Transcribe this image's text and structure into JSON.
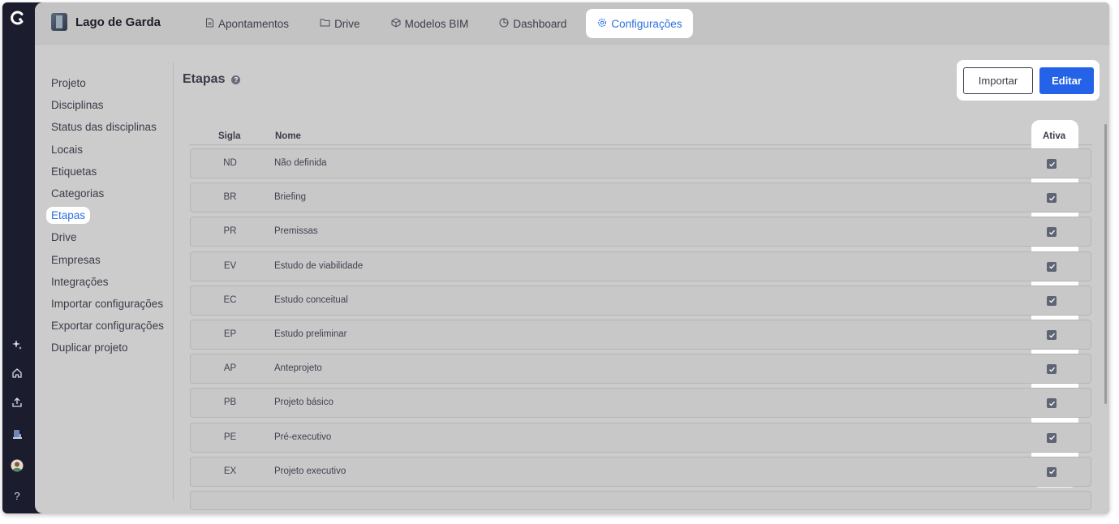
{
  "project": {
    "name": "Lago de Garda"
  },
  "tabs": [
    {
      "label": "Apontamentos",
      "icon": "document-icon"
    },
    {
      "label": "Drive",
      "icon": "folder-icon"
    },
    {
      "label": "Modelos BIM",
      "icon": "cube-icon"
    },
    {
      "label": "Dashboard",
      "icon": "pie-chart-icon"
    },
    {
      "label": "Configurações",
      "icon": "gear-icon",
      "active": true
    }
  ],
  "sidebar": {
    "items": [
      {
        "label": "Projeto"
      },
      {
        "label": "Disciplinas"
      },
      {
        "label": "Status das disciplinas"
      },
      {
        "label": "Locais"
      },
      {
        "label": "Etiquetas"
      },
      {
        "label": "Categorias"
      },
      {
        "label": "Etapas",
        "active": true
      },
      {
        "label": "Drive"
      },
      {
        "label": "Empresas"
      },
      {
        "label": "Integrações"
      },
      {
        "label": "Importar configurações"
      },
      {
        "label": "Exportar configurações"
      },
      {
        "label": "Duplicar projeto"
      }
    ]
  },
  "page": {
    "title": "Etapas",
    "help_glyph": "?",
    "import_label": "Importar",
    "edit_label": "Editar"
  },
  "table": {
    "headers": {
      "sigla": "Sigla",
      "nome": "Nome",
      "ativa": "Ativa"
    },
    "rows": [
      {
        "sigla": "ND",
        "nome": "Não definida",
        "ativa": true
      },
      {
        "sigla": "BR",
        "nome": "Briefing",
        "ativa": true
      },
      {
        "sigla": "PR",
        "nome": "Premissas",
        "ativa": true
      },
      {
        "sigla": "EV",
        "nome": "Estudo de viabilidade",
        "ativa": true
      },
      {
        "sigla": "EC",
        "nome": "Estudo conceitual",
        "ativa": true
      },
      {
        "sigla": "EP",
        "nome": "Estudo preliminar",
        "ativa": true
      },
      {
        "sigla": "AP",
        "nome": "Anteprojeto",
        "ativa": true
      },
      {
        "sigla": "PB",
        "nome": "Projeto básico",
        "ativa": true
      },
      {
        "sigla": "PE",
        "nome": "Pré-executivo",
        "ativa": true
      },
      {
        "sigla": "EX",
        "nome": "Projeto executivo",
        "ativa": true
      },
      {
        "sigla": "",
        "nome": "",
        "ativa": true
      }
    ]
  },
  "rail": {
    "icons": [
      "sparkle-icon",
      "home-icon",
      "upload-icon",
      "building-icon",
      "user-avatar-icon",
      "help-icon"
    ],
    "help_glyph": "?"
  },
  "colors": {
    "accent": "#2463e8",
    "rail_bg": "#1b1c2e",
    "overlay_bg": "#cccccc"
  }
}
